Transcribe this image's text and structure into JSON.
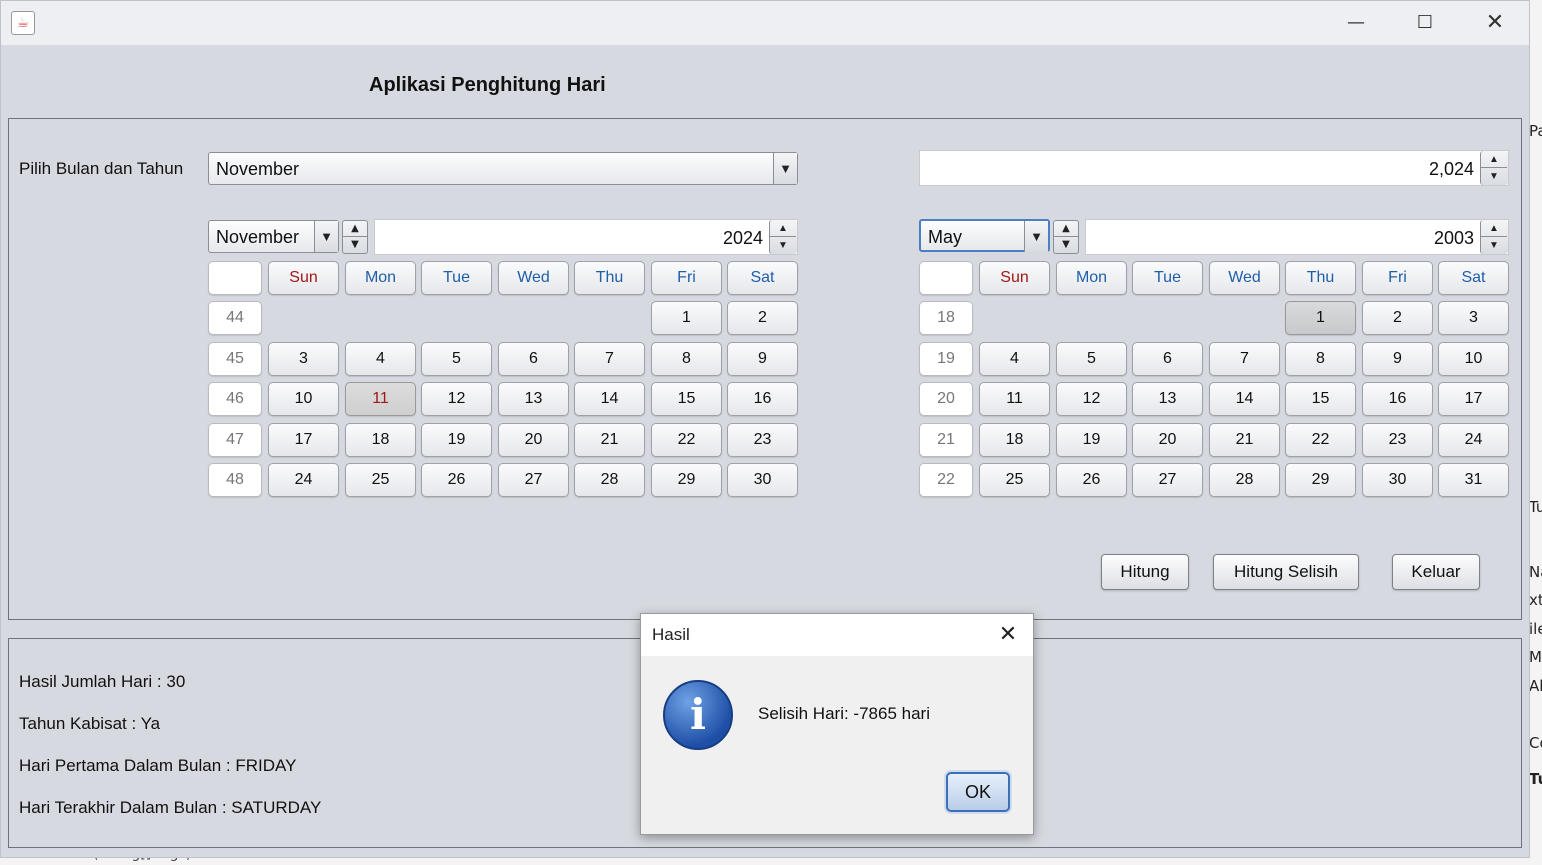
{
  "window": {
    "app_title": "Aplikasi Penghitung Hari",
    "controls": {
      "minimize": "—",
      "maximize": "☐",
      "close": "✕"
    }
  },
  "top_panel": {
    "select_label": "Pilih Bulan dan Tahun",
    "month_combo": "November",
    "year_spinner": "2,024",
    "left_calendar": {
      "month": "November",
      "year": "2024",
      "headers": [
        "",
        "Sun",
        "Mon",
        "Tue",
        "Wed",
        "Thu",
        "Fri",
        "Sat"
      ],
      "weeks": [
        {
          "week": "44",
          "days": [
            "",
            "",
            "",
            "",
            "",
            "1",
            "2"
          ]
        },
        {
          "week": "45",
          "days": [
            "3",
            "4",
            "5",
            "6",
            "7",
            "8",
            "9"
          ]
        },
        {
          "week": "46",
          "days": [
            "10",
            "11",
            "12",
            "13",
            "14",
            "15",
            "16"
          ]
        },
        {
          "week": "47",
          "days": [
            "17",
            "18",
            "19",
            "20",
            "21",
            "22",
            "23"
          ]
        },
        {
          "week": "48",
          "days": [
            "24",
            "25",
            "26",
            "27",
            "28",
            "29",
            "30"
          ]
        }
      ],
      "selected_day": "11"
    },
    "right_calendar": {
      "month": "May",
      "year": "2003",
      "headers": [
        "",
        "Sun",
        "Mon",
        "Tue",
        "Wed",
        "Thu",
        "Fri",
        "Sat"
      ],
      "weeks": [
        {
          "week": "18",
          "days": [
            "",
            "",
            "",
            "",
            "1",
            "2",
            "3"
          ]
        },
        {
          "week": "19",
          "days": [
            "4",
            "5",
            "6",
            "7",
            "8",
            "9",
            "10"
          ]
        },
        {
          "week": "20",
          "days": [
            "11",
            "12",
            "13",
            "14",
            "15",
            "16",
            "17"
          ]
        },
        {
          "week": "21",
          "days": [
            "18",
            "19",
            "20",
            "21",
            "22",
            "23",
            "24"
          ]
        },
        {
          "week": "22",
          "days": [
            "25",
            "26",
            "27",
            "28",
            "29",
            "30",
            "31"
          ]
        }
      ],
      "selected_day": "1"
    },
    "buttons": {
      "hitung": "Hitung",
      "hitung_selisih": "Hitung Selisih",
      "keluar": "Keluar"
    }
  },
  "bottom_panel": {
    "jumlah_hari": "Hasil Jumlah Hari : 30",
    "tahun_kabisat": "Tahun Kabisat : Ya",
    "hari_pertama": "Hari Pertama Dalam Bulan : FRIDAY",
    "hari_terakhir": "Hari Terakhir Dalam Bulan : SATURDAY"
  },
  "dialog": {
    "title": "Hasil",
    "message": "Selisih Hari: -7865 hari",
    "ok": "OK",
    "icon": "info-icon"
  },
  "background_ide": {
    "sidebar_fragments": [
      "Pa",
      "Tu",
      "Na",
      "xt",
      "ile",
      "Mo",
      "All",
      "Co",
      "Tu"
    ],
    "bottom_text": "main(String[] args)"
  },
  "colors": {
    "window_bg": "#d6d9df",
    "header_blue": "#1f5fa8",
    "sunday_red": "#a01818",
    "dialog_focus": "#3d6fb6"
  }
}
